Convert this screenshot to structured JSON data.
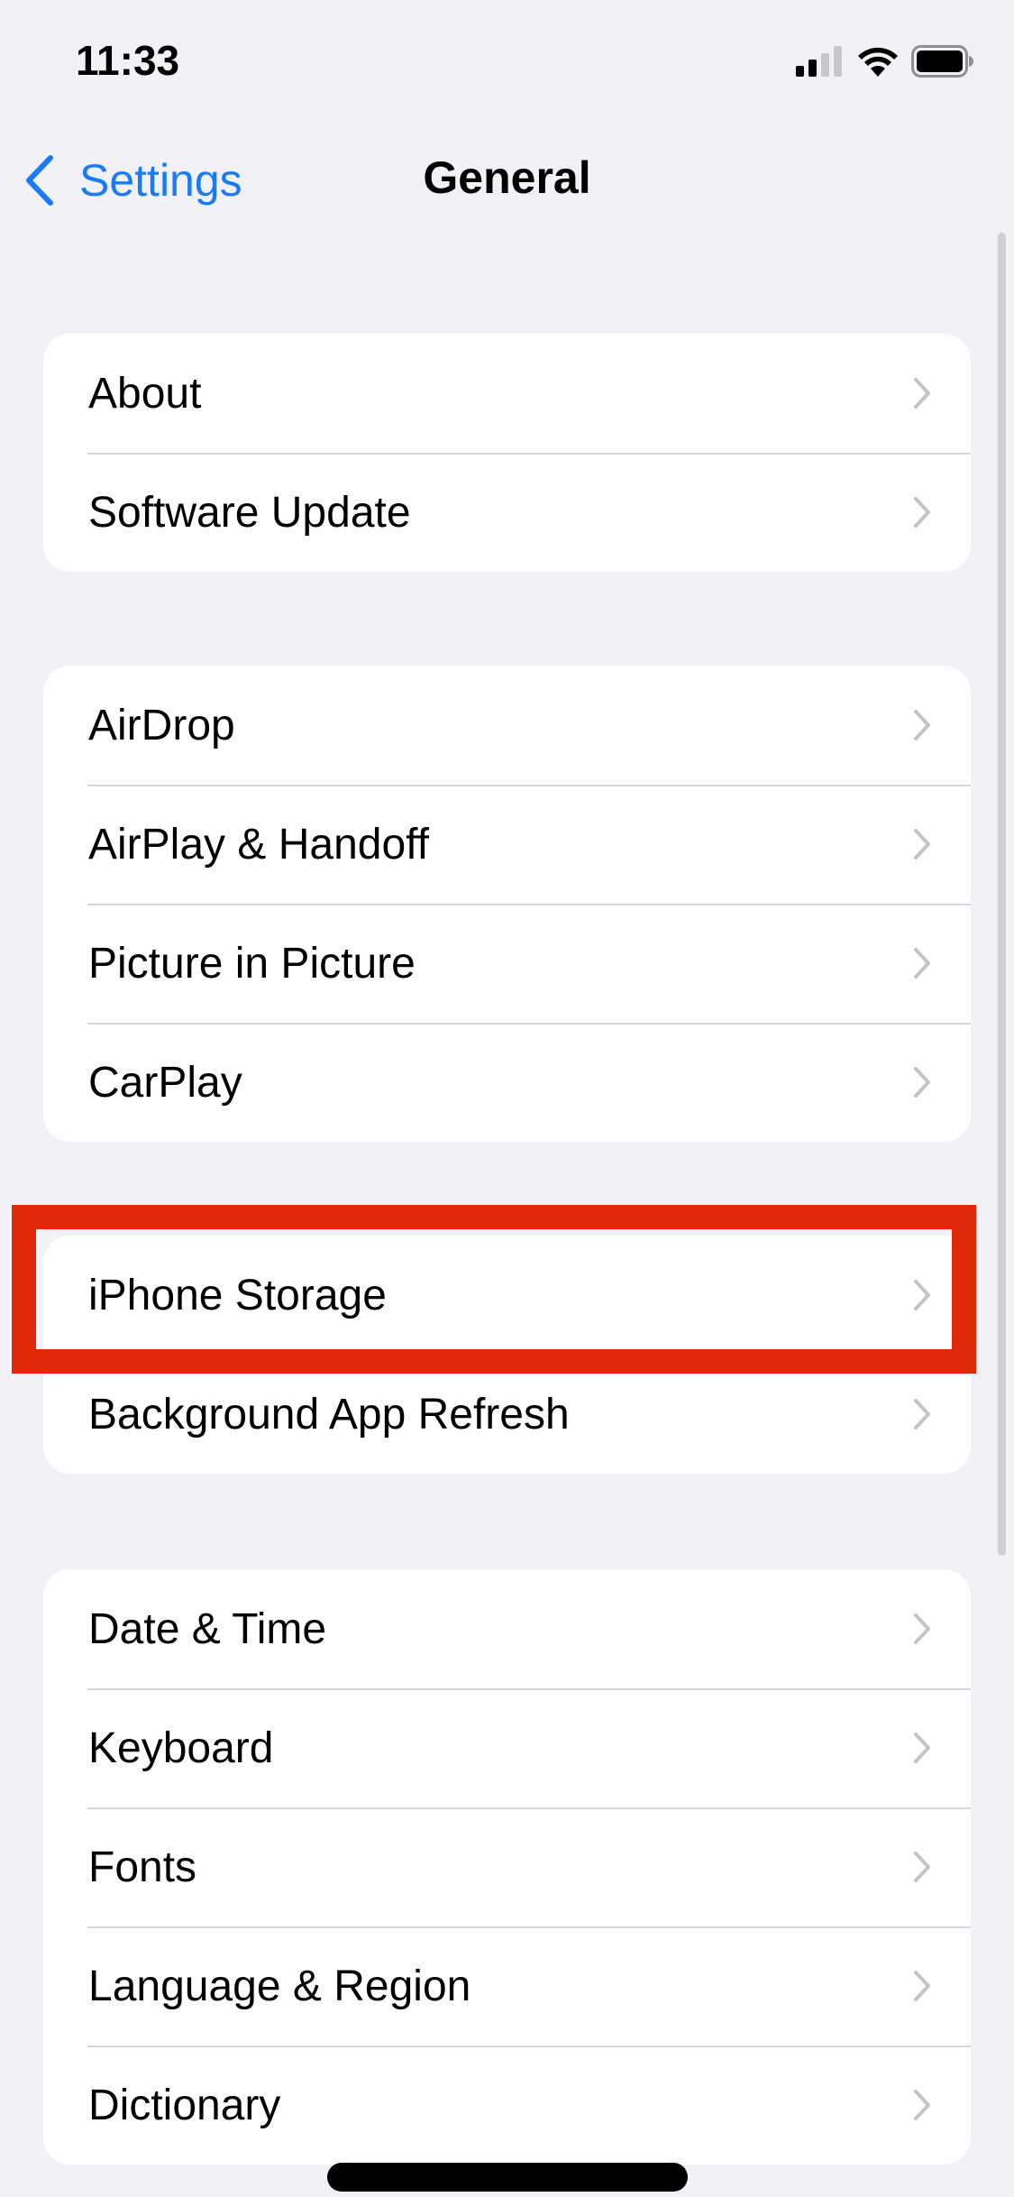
{
  "status_bar": {
    "time": "11:33",
    "icons": [
      "cellular-signal-icon",
      "wifi-icon",
      "battery-icon"
    ]
  },
  "nav": {
    "back_label": "Settings",
    "title": "General"
  },
  "groups": [
    {
      "items": [
        {
          "label": "About"
        },
        {
          "label": "Software Update"
        }
      ]
    },
    {
      "items": [
        {
          "label": "AirDrop"
        },
        {
          "label": "AirPlay & Handoff"
        },
        {
          "label": "Picture in Picture"
        },
        {
          "label": "CarPlay"
        }
      ]
    },
    {
      "items": [
        {
          "label": "iPhone Storage",
          "highlighted": true
        },
        {
          "label": "Background App Refresh"
        }
      ]
    },
    {
      "items": [
        {
          "label": "Date & Time"
        },
        {
          "label": "Keyboard"
        },
        {
          "label": "Fonts"
        },
        {
          "label": "Language & Region"
        },
        {
          "label": "Dictionary"
        }
      ]
    }
  ],
  "colors": {
    "accent": "#1a7cf5",
    "background": "#f1f1f6",
    "highlight": "#e0280b",
    "chevron": "#c4c4c7"
  }
}
